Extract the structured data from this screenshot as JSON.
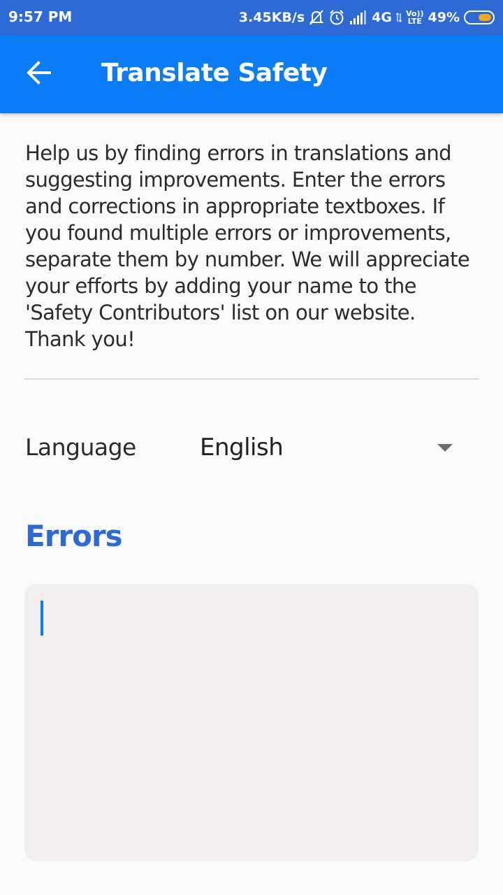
{
  "status_bar": {
    "time": "9:57 PM",
    "net_speed": "3.45KB/s",
    "network_type": "4G",
    "volte_top": "Vo))",
    "volte_bottom": "LTE",
    "battery_percent": "49%",
    "battery_level": 0.49,
    "icons": [
      "muted-bell-icon",
      "alarm-icon",
      "signal-icon",
      "battery-icon"
    ],
    "background": "#2e6ad6"
  },
  "app_bar": {
    "title": "Translate Safety",
    "back_icon": "arrow-left-icon",
    "background": "#0a7cf5"
  },
  "intro": {
    "text": "Help us by finding errors in translations and suggesting improvements. Enter the errors and corrections in appropriate textboxes. If you found multiple errors or improvements, separate them by number. We will appreciate your efforts by adding your name to the 'Safety Contributors' list on our website. Thank you!"
  },
  "language": {
    "label": "Language",
    "selected": "English",
    "arrow_icon": "dropdown-arrow-icon"
  },
  "errors": {
    "heading": "Errors",
    "heading_color": "#2e6ad6",
    "value": ""
  }
}
